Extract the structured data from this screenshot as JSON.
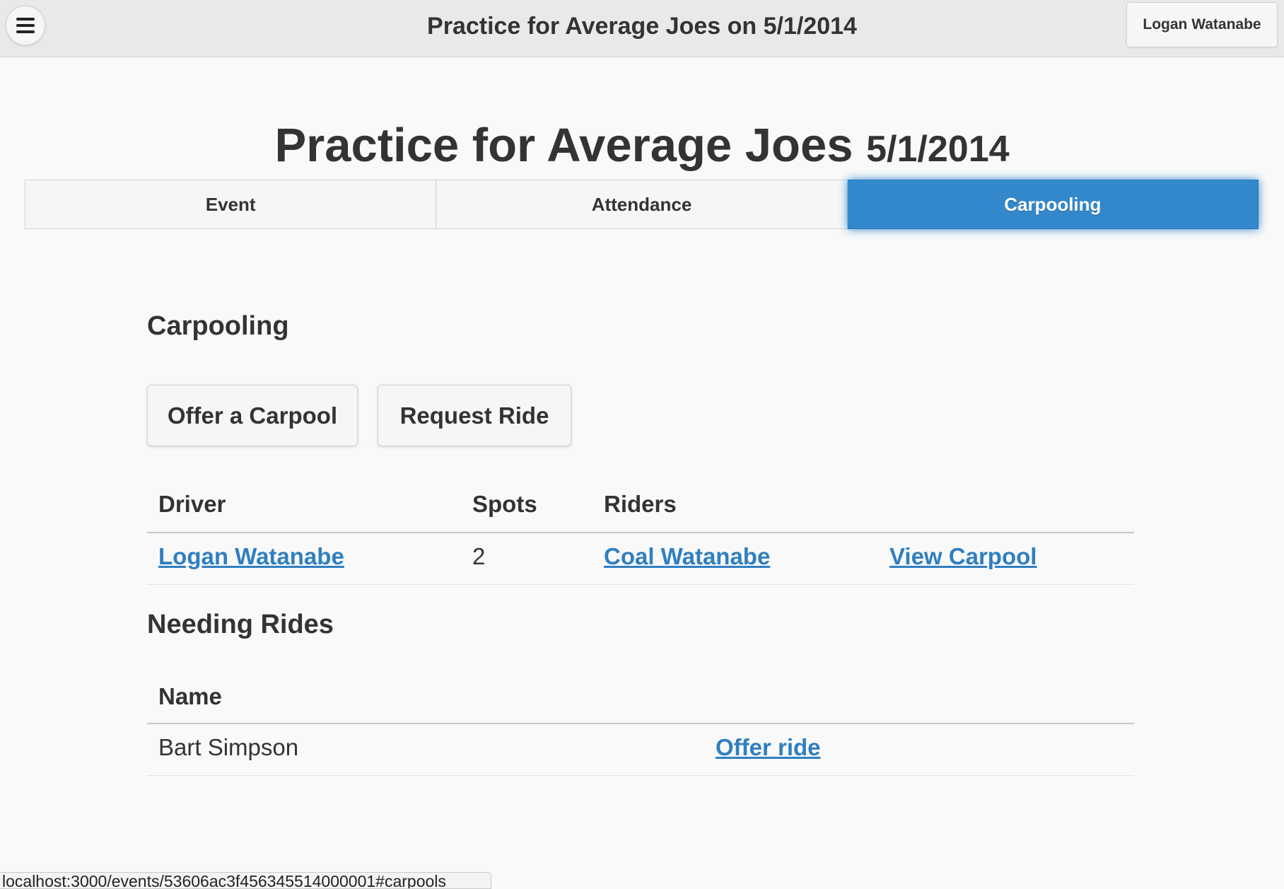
{
  "header": {
    "menu_icon": "hamburger-menu-icon",
    "title": "Practice for Average Joes on 5/1/2014",
    "user_button": "Logan Watanabe"
  },
  "page": {
    "heading": "Practice for Average Joes",
    "heading_date": "5/1/2014"
  },
  "tabs": [
    {
      "label": "Event",
      "active": false
    },
    {
      "label": "Attendance",
      "active": false
    },
    {
      "label": "Carpooling",
      "active": true
    }
  ],
  "carpooling": {
    "title": "Carpooling",
    "offer_button": "Offer a Carpool",
    "request_button": "Request Ride",
    "columns": {
      "driver": "Driver",
      "spots": "Spots",
      "riders": "Riders"
    },
    "rows": [
      {
        "driver": "Logan Watanabe",
        "spots": "2",
        "rider": "Coal Watanabe",
        "action": "View Carpool"
      }
    ]
  },
  "needing_rides": {
    "title": "Needing Rides",
    "columns": {
      "name": "Name"
    },
    "rows": [
      {
        "name": "Bart Simpson",
        "action": "Offer ride"
      }
    ]
  },
  "status_bar": {
    "url": "localhost:3000/events/53606ac3f456345514000001#carpools"
  },
  "colors": {
    "accent": "#3388cc",
    "link": "#2f7fc1",
    "background": "#f9f9f9",
    "header": "#e9e9e9"
  }
}
